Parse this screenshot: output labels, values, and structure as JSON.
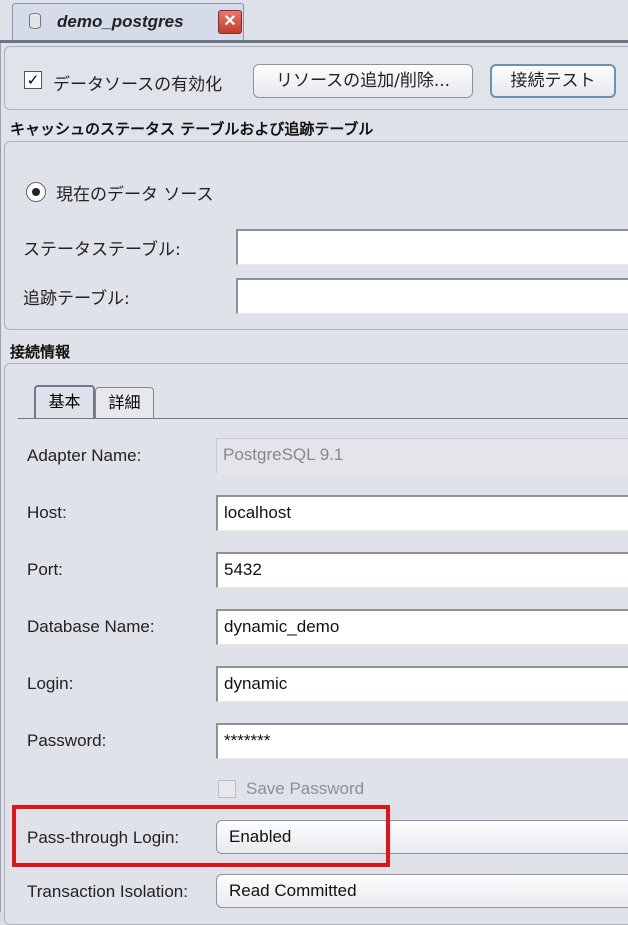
{
  "document_tab": {
    "title": "demo_postgres",
    "close_icon": "close-icon"
  },
  "toolbar": {
    "enable_checkbox_label": "データソースの有効化",
    "enable_checked": true,
    "add_remove_button": "リソースの追加/削除...",
    "test_connection_button": "接続テスト"
  },
  "cache_section": {
    "title": "キャッシュのステータス テーブルおよび追跡テーブル",
    "radio_label": "現在のデータ ソース",
    "status_table_label": "ステータステーブル:",
    "status_table_value": "",
    "tracking_table_label": "追跡テーブル:",
    "tracking_table_value": ""
  },
  "connection_section": {
    "title": "接続情報",
    "tabs": [
      "基本",
      "詳細"
    ],
    "active_tab": "基本",
    "fields": {
      "adapter_name": {
        "label": "Adapter Name:",
        "value": "PostgreSQL 9.1"
      },
      "host": {
        "label": "Host:",
        "value": "localhost"
      },
      "port": {
        "label": "Port:",
        "value": "5432"
      },
      "database_name": {
        "label": "Database Name:",
        "value": "dynamic_demo"
      },
      "login": {
        "label": "Login:",
        "value": "dynamic"
      },
      "password": {
        "label": "Password:",
        "value": "*******"
      },
      "save_password": {
        "label": "Save Password",
        "checked": false
      },
      "pass_through_login": {
        "label": "Pass-through Login:",
        "value": "Enabled"
      },
      "transaction_isolation": {
        "label": "Transaction Isolation:",
        "value": "Read Committed"
      }
    }
  },
  "highlight_color": "#e0151b"
}
